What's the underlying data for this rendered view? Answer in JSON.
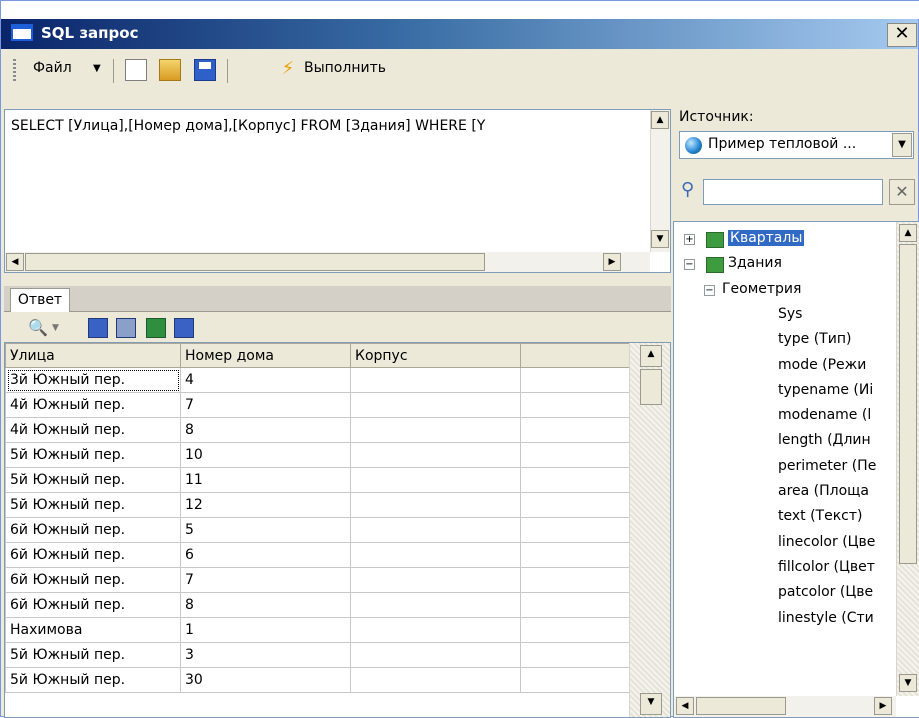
{
  "window": {
    "title": "SQL запрос"
  },
  "toolbar": {
    "file_label": "Файл",
    "run_label": "Выполнить"
  },
  "query": {
    "text": "SELECT [Улица],[Номер дома],[Корпус] FROM [Здания]  WHERE [Y"
  },
  "answer": {
    "tab_label": "Ответ"
  },
  "grid": {
    "columns": [
      "Улица",
      "Номер дома",
      "Корпус",
      ""
    ],
    "rows": [
      [
        "3й Южный пер.",
        "4",
        ""
      ],
      [
        "4й Южный пер.",
        "7",
        ""
      ],
      [
        "4й Южный пер.",
        "8",
        ""
      ],
      [
        "5й Южный пер.",
        "10",
        ""
      ],
      [
        "5й Южный пер.",
        "11",
        ""
      ],
      [
        "5й Южный пер.",
        "12",
        ""
      ],
      [
        "6й Южный пер.",
        "5",
        ""
      ],
      [
        "6й Южный пер.",
        "6",
        ""
      ],
      [
        "6й Южный пер.",
        "7",
        ""
      ],
      [
        "6й Южный пер.",
        "8",
        ""
      ],
      [
        "Нахимова",
        "1",
        ""
      ],
      [
        "5й Южный пер.",
        "3",
        ""
      ],
      [
        "5й Южный пер.",
        "30",
        ""
      ]
    ]
  },
  "source": {
    "label": "Источник:",
    "selected": "Пример тепловой ..."
  },
  "tree": {
    "nodes": [
      {
        "label": "Кварталы",
        "level": 0,
        "toggle": "+"
      },
      {
        "label": "Здания",
        "level": 0,
        "toggle": "−"
      },
      {
        "label": "Геометрия",
        "level": 1,
        "toggle": "−"
      },
      {
        "label": "Sys",
        "level": 2
      },
      {
        "label": "type (Тип)",
        "level": 2
      },
      {
        "label": "mode (Режи",
        "level": 2
      },
      {
        "label": "typename (Иі",
        "level": 2
      },
      {
        "label": "modename (l",
        "level": 2
      },
      {
        "label": "length (Длин",
        "level": 2
      },
      {
        "label": "perimeter (Пе",
        "level": 2
      },
      {
        "label": "area (Площа",
        "level": 2
      },
      {
        "label": "text (Текст)",
        "level": 2
      },
      {
        "label": "linecolor (Цве",
        "level": 2
      },
      {
        "label": "fillcolor (Цвет",
        "level": 2
      },
      {
        "label": "patcolor (Цве",
        "level": 2
      },
      {
        "label": "linestyle (Сти",
        "level": 2
      }
    ]
  }
}
